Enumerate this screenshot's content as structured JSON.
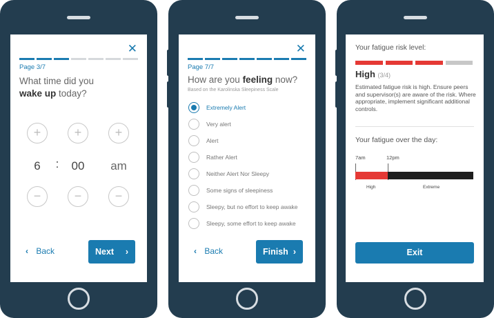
{
  "screen1": {
    "close_icon": "✕",
    "progress_total": 7,
    "progress_filled": 3,
    "page_label": "Page 3/7",
    "question_pre": "What time did you",
    "question_bold": "wake up",
    "question_post": "today?",
    "hour": "6",
    "separator": ":",
    "minute": "00",
    "ampm": "am",
    "plus_icon": "+",
    "minus_icon": "−",
    "back_chevron": "‹",
    "back_label": "Back",
    "next_label": "Next",
    "next_chevron": "›"
  },
  "screen2": {
    "close_icon": "✕",
    "progress_total": 7,
    "progress_filled": 7,
    "page_label": "Page 7/7",
    "question_pre": "How are you",
    "question_bold": "feeling",
    "question_post": "now?",
    "subtitle": "Based on the Karolinska Sleepiness Scale",
    "options": [
      {
        "label": "Extremely Alert",
        "selected": true
      },
      {
        "label": "Very alert",
        "selected": false
      },
      {
        "label": "Alert",
        "selected": false
      },
      {
        "label": "Rather Alert",
        "selected": false
      },
      {
        "label": "Neither Alert Nor Sleepy",
        "selected": false
      },
      {
        "label": "Some signs of sleepiness",
        "selected": false
      },
      {
        "label": "Sleepy, but no effort to keep awake",
        "selected": false
      },
      {
        "label": "Sleepy, some effort to keep awake",
        "selected": false
      }
    ],
    "back_chevron": "‹",
    "back_label": "Back",
    "finish_label": "Finish",
    "finish_chevron": "›"
  },
  "screen3": {
    "risk_title": "Your fatigue risk level:",
    "risk_level": "High",
    "risk_score": "(3/4)",
    "risk_value": 3,
    "risk_max": 4,
    "risk_desc": "Estimated fatigue risk is high. Ensure peers and supervisor(s) are aware of the risk. Where appropriate, implement significant additional controls.",
    "day_title": "Your fatigue over the day:",
    "time_start": "7am",
    "time_mid": "12pm",
    "bar_high_label": "High",
    "bar_extreme_label": "Extreme",
    "exit_label": "Exit"
  },
  "colors": {
    "phone_body": "#233d4f",
    "accent": "#1a7bb0",
    "risk_red": "#e53935",
    "fatigue_extreme": "#1e1e1e",
    "inactive": "#c7c7c7"
  }
}
